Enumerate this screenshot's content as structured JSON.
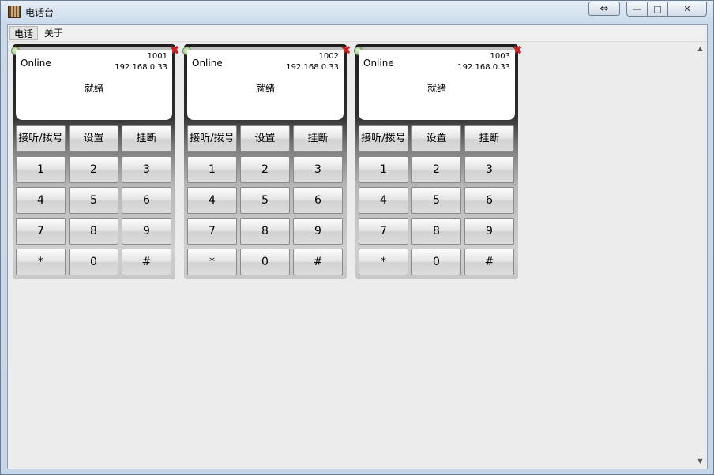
{
  "window": {
    "title": "电话台",
    "restore_glyph": "⇔",
    "min_glyph": "—",
    "max_glyph": "□",
    "close_glyph": "✕"
  },
  "menu": {
    "items": [
      {
        "label": "电话"
      },
      {
        "label": "关于"
      }
    ]
  },
  "scroll": {
    "up": "▲",
    "down": "▼"
  },
  "phones": [
    {
      "ext": "1001",
      "ip": "192.168.0.33",
      "state": "Online",
      "status": "就绪"
    },
    {
      "ext": "1002",
      "ip": "192.168.0.33",
      "state": "Online",
      "status": "就绪"
    },
    {
      "ext": "1003",
      "ip": "192.168.0.33",
      "state": "Online",
      "status": "就绪"
    }
  ],
  "keypad": {
    "answer": "接听/拨号",
    "settings": "设置",
    "hangup": "挂断",
    "keys": [
      "1",
      "2",
      "3",
      "4",
      "5",
      "6",
      "7",
      "8",
      "9",
      "*",
      "0",
      "#"
    ]
  },
  "close_glyph": "✖",
  "colors": {
    "close": "#c42424",
    "status_ok": "#7fb36a"
  }
}
